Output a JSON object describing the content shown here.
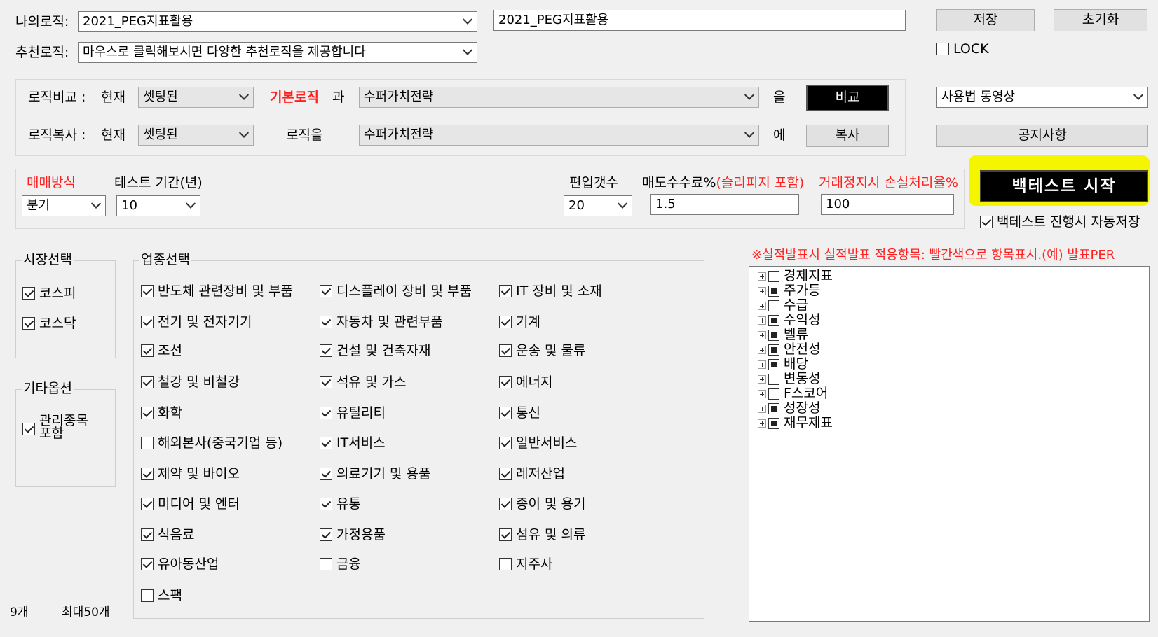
{
  "top": {
    "my_logic_label": "나의로직:",
    "my_logic_value": "2021_PEG지표활용",
    "logic_name_value": "2021_PEG지표활용",
    "save_label": "저장",
    "reset_label": "초기화",
    "recommend_label": "추천로직:",
    "recommend_value": "마우스로 클릭해보시면 다양한 추천로직을 제공합니다",
    "lock_label": "LOCK",
    "lock_checked": false
  },
  "compare": {
    "compare_label": "로직비교 :",
    "now_label": "현재",
    "compare_current": "셋팅된",
    "base_logic_label": "기본로직",
    "and_label": "과",
    "compare_target": "수퍼가치전략",
    "eul_label": "을",
    "compare_button": "비교",
    "copy_label": "로직복사 :",
    "copy_now_label": "현재",
    "copy_current": "셋팅된",
    "logic_eul_label": "로직을",
    "copy_target": "수퍼가치전략",
    "e_label": "에",
    "copy_button": "복사",
    "video_select": "사용법 동영상",
    "notice_button": "공지사항"
  },
  "settings": {
    "trade_method_label": "매매방식",
    "trade_method_value": "분기",
    "period_label": "테스트 기간(년)",
    "period_value": "10",
    "holdings_label": "편입갯수",
    "holdings_value": "20",
    "fee_label": "매도수수료%",
    "fee_note": "(슬리피지 포함)",
    "fee_value": "1.5",
    "halt_label": "거래정지시 손실처리율%",
    "halt_value": "100",
    "start_button": "백테스트 시작",
    "autosave_label": "백테스트 진행시 자동저장",
    "autosave_checked": true
  },
  "market": {
    "title": "시장선택",
    "items": [
      {
        "label": "코스피",
        "checked": true
      },
      {
        "label": "코스닥",
        "checked": true
      }
    ]
  },
  "other": {
    "title": "기타옵션",
    "item_label_1": "관리종목",
    "item_label_2": "포함",
    "checked": true
  },
  "sector": {
    "title": "업종선택",
    "items": [
      {
        "label": "반도체 관련장비 및 부품",
        "checked": true
      },
      {
        "label": "디스플레이 장비 및 부품",
        "checked": true
      },
      {
        "label": "IT 장비 및 소재",
        "checked": true
      },
      {
        "label": "전기 및 전자기기",
        "checked": true
      },
      {
        "label": "자동차 및 관련부품",
        "checked": true
      },
      {
        "label": "기계",
        "checked": true
      },
      {
        "label": "조선",
        "checked": true
      },
      {
        "label": "건설 및 건축자재",
        "checked": true
      },
      {
        "label": "운송 및 물류",
        "checked": true
      },
      {
        "label": "철강 및 비철강",
        "checked": true
      },
      {
        "label": "석유 및 가스",
        "checked": true
      },
      {
        "label": "에너지",
        "checked": true
      },
      {
        "label": "화학",
        "checked": true
      },
      {
        "label": "유틸리티",
        "checked": true
      },
      {
        "label": "통신",
        "checked": true
      },
      {
        "label": "해외본사(중국기업 등)",
        "checked": false
      },
      {
        "label": "IT서비스",
        "checked": true
      },
      {
        "label": "일반서비스",
        "checked": true
      },
      {
        "label": "제약 및 바이오",
        "checked": true
      },
      {
        "label": "의료기기 및 용품",
        "checked": true
      },
      {
        "label": "레저산업",
        "checked": true
      },
      {
        "label": "미디어 및 엔터",
        "checked": true
      },
      {
        "label": "유통",
        "checked": true
      },
      {
        "label": "종이 및 용기",
        "checked": true
      },
      {
        "label": "식음료",
        "checked": true
      },
      {
        "label": "가정용품",
        "checked": true
      },
      {
        "label": "섬유 및 의류",
        "checked": true
      },
      {
        "label": "유아동산업",
        "checked": true
      },
      {
        "label": "금융",
        "checked": false
      },
      {
        "label": "지주사",
        "checked": false
      },
      {
        "label": "스팩",
        "checked": false
      }
    ]
  },
  "indicators": {
    "note": "※실적발표시 실적발표 적용항목: 빨간색으로 항목표시.(예) 발표PER",
    "items": [
      {
        "label": "경제지표",
        "state": "empty"
      },
      {
        "label": "주가등",
        "state": "partial"
      },
      {
        "label": "수급",
        "state": "empty"
      },
      {
        "label": "수익성",
        "state": "partial"
      },
      {
        "label": "벨류",
        "state": "partial"
      },
      {
        "label": "안전성",
        "state": "partial"
      },
      {
        "label": "배당",
        "state": "partial"
      },
      {
        "label": "변동성",
        "state": "empty"
      },
      {
        "label": "F스코어",
        "state": "empty"
      },
      {
        "label": "성장성",
        "state": "partial"
      },
      {
        "label": "재무제표",
        "state": "partial"
      }
    ]
  },
  "footer": {
    "count_label": "9개",
    "max_label": "최대50개"
  }
}
